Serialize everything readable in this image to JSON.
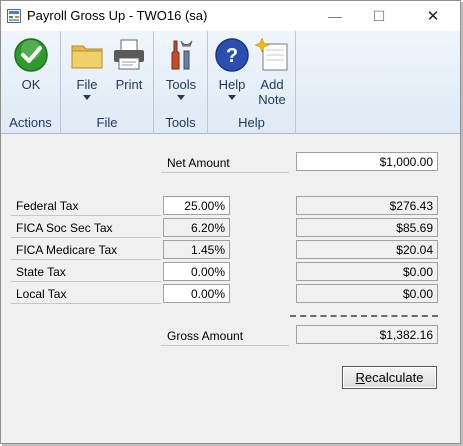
{
  "window": {
    "title": "Payroll Gross Up  -  TWO16 (sa)",
    "minimize_glyph": "—",
    "maximize_glyph": "☐",
    "close_glyph": "✕"
  },
  "ribbon": {
    "groups": [
      {
        "label": "Actions",
        "buttons": [
          {
            "label": "OK",
            "icon": "ok-check-icon"
          }
        ]
      },
      {
        "label": "File",
        "buttons": [
          {
            "label": "File",
            "icon": "folder-icon",
            "dropdown": true
          },
          {
            "label": "Print",
            "icon": "printer-icon"
          }
        ]
      },
      {
        "label": "Tools",
        "buttons": [
          {
            "label": "Tools",
            "icon": "tools-icon",
            "dropdown": true
          }
        ]
      },
      {
        "label": "Help",
        "buttons": [
          {
            "label": "Help",
            "icon": "help-question-icon",
            "dropdown": true
          },
          {
            "label": "Add",
            "label2": "Note",
            "icon": "add-note-icon"
          }
        ]
      }
    ]
  },
  "form": {
    "net_amount": {
      "label": "Net Amount",
      "value": "$1,000.00"
    },
    "taxes": [
      {
        "label": "Federal Tax",
        "rate": "25.00%",
        "amount": "$276.43",
        "editable": true
      },
      {
        "label": "FICA Soc Sec Tax",
        "rate": "6.20%",
        "amount": "$85.69",
        "editable": false
      },
      {
        "label": "FICA Medicare Tax",
        "rate": "1.45%",
        "amount": "$20.04",
        "editable": false
      },
      {
        "label": "State Tax",
        "rate": "0.00%",
        "amount": "$0.00",
        "editable": true
      },
      {
        "label": "Local Tax",
        "rate": "0.00%",
        "amount": "$0.00",
        "editable": true
      }
    ],
    "gross_amount": {
      "label": "Gross Amount",
      "value": "$1,382.16"
    },
    "recalculate": {
      "accel": "R",
      "rest": "ecalculate"
    }
  },
  "colors": {
    "ok_green": "#2e9a2e",
    "help_blue": "#2a4fb0",
    "ribbon_text": "#1f3a63"
  }
}
